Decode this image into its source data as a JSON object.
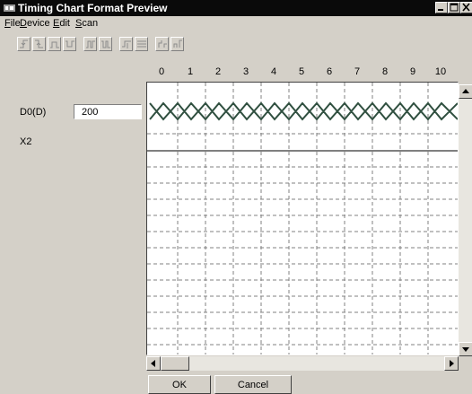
{
  "window": {
    "title": "Timing Chart Format Preview"
  },
  "menu": [
    {
      "key": "F",
      "rest": "ile"
    },
    {
      "key": "D",
      "rest": "evice"
    },
    {
      "key": "E",
      "rest": "dit"
    },
    {
      "key": "S",
      "rest": "can"
    }
  ],
  "toolbar_icons": [
    "rise-edge-icon",
    "fall-edge-icon",
    "pulse-icon",
    "pulse-low-icon",
    "double-edge-icon",
    "double-edge-alt-icon",
    "insert-icon",
    "delete-icon",
    "zoom-in-icon",
    "zoom-out-icon"
  ],
  "ruler": [
    "0",
    "1",
    "2",
    "3",
    "4",
    "5",
    "6",
    "7",
    "8",
    "9",
    "10"
  ],
  "signals": [
    {
      "name": "D0(D)",
      "value": "200"
    },
    {
      "name": "X2"
    }
  ],
  "buttons": {
    "ok": "OK",
    "cancel": "Cancel"
  },
  "colors": {
    "titlebar": "#0a0a0a",
    "face": "#d4d0c8",
    "waveform": "#2f4f3f",
    "grid": "#808080"
  }
}
